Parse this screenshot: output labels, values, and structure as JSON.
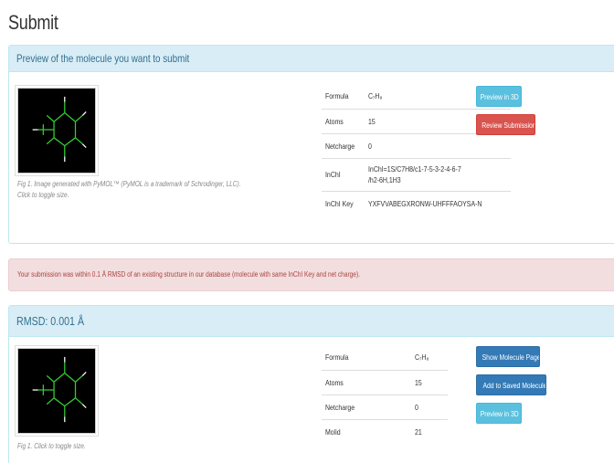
{
  "page": {
    "title": "Submit"
  },
  "preview_panel": {
    "heading": "Preview of the molecule you want to submit",
    "caption_line1": "Fig 1. Image generated with PyMOL™ (PyMOL is a trademark of Schrodinger, LLC).",
    "caption_line2": "Click to toggle size.",
    "properties": [
      {
        "label": "Formula",
        "value": "C₇H₈"
      },
      {
        "label": "Atoms",
        "value": "15"
      },
      {
        "label": "Netcharge",
        "value": "0"
      },
      {
        "label": "InChI",
        "value": "InChI=1S/C7H8/c1-7-5-3-2-4-6-7",
        "value2": "/h2-6H,1H3"
      },
      {
        "label": "InChI Key",
        "value": "YXFVVABEGXRONW-UHFFFAOYSA-N"
      }
    ],
    "buttons": {
      "preview3d": "Preview in 3D",
      "review": "Review Submission"
    }
  },
  "alert": {
    "text": "Your submission was within 0.1 Å RMSD of an existing structure in our database (molecule with same InChI Key and net charge)."
  },
  "match_panel": {
    "heading": "RMSD: 0.001 Å",
    "caption": "Fig 1. Click to toggle size.",
    "properties": [
      {
        "label": "Formula",
        "value": "C₇H₈"
      },
      {
        "label": "Atoms",
        "value": "15"
      },
      {
        "label": "Netcharge",
        "value": "0"
      },
      {
        "label": "Molid",
        "value": "21"
      }
    ],
    "buttons": {
      "show": "Show Molecule Page",
      "add": "Add to Saved Molecules",
      "preview3d": "Preview in 3D"
    }
  },
  "colors": {
    "panel_heading_bg": "#d9edf7",
    "panel_heading_text": "#31708f",
    "alert_bg": "#f2dede",
    "alert_text": "#a94442",
    "btn_info": "#5bc0de",
    "btn_danger": "#d9534f",
    "btn_primary": "#337ab7",
    "molecule_line": "#33cc33"
  }
}
